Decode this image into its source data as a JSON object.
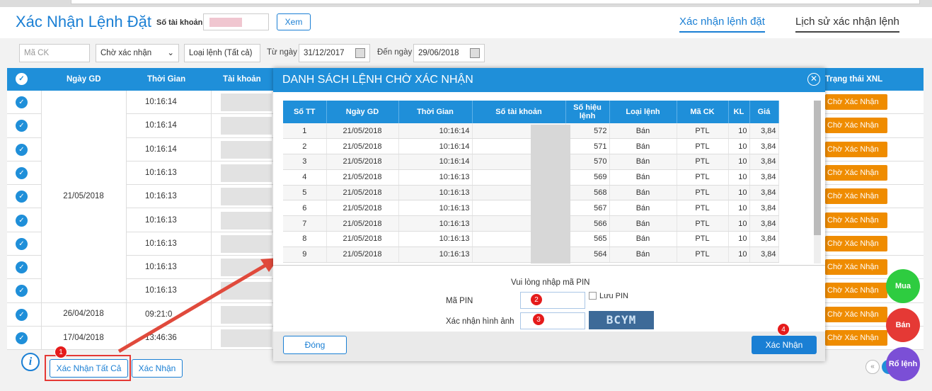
{
  "header": {
    "title": "Xác Nhận Lệnh Đặt",
    "account_label": "Số tài khoản",
    "view_button": "Xem",
    "tabs": [
      "Xác nhận lệnh đặt",
      "Lịch sử xác nhận lệnh"
    ]
  },
  "filters": {
    "stock_placeholder": "Mã CK",
    "status": "Chờ xác nhận",
    "order_type": "Loại lệnh (Tất cả)",
    "from_label": "Từ ngày",
    "from_date": "31/12/2017",
    "to_label": "Đến ngày",
    "to_date": "29/06/2018"
  },
  "grid": {
    "columns": [
      "Ngày GD",
      "Thời Gian",
      "Tài khoản",
      "Trạng thái XNL"
    ],
    "rows": [
      {
        "time": "10:16:14",
        "status": "Chờ Xác Nhận"
      },
      {
        "time": "10:16:14",
        "status": "Chờ Xác Nhận"
      },
      {
        "time": "10:16:14",
        "status": "Chờ Xác Nhận"
      },
      {
        "time": "10:16:13",
        "status": "Chờ Xác Nhận"
      },
      {
        "time": "10:16:13",
        "status": "Chờ Xác Nhận"
      },
      {
        "time": "10:16:13",
        "status": "Chờ Xác Nhận"
      },
      {
        "time": "10:16:13",
        "status": "Chờ Xác Nhận"
      },
      {
        "time": "10:16:13",
        "status": "Chờ Xác Nhận"
      },
      {
        "time": "10:16:13",
        "status": "Chờ Xác Nhận"
      },
      {
        "time": "09:21:0",
        "status": "Chờ Xác Nhận"
      },
      {
        "time": "13:46:36",
        "status": "Chờ Xác Nhận"
      }
    ],
    "date_groups": [
      "21/05/2018",
      "26/04/2018",
      "17/04/2018"
    ]
  },
  "modal": {
    "title": "DANH SÁCH LỆNH CHỜ XÁC NHẬN",
    "columns": [
      "Số TT",
      "Ngày GD",
      "Thời Gian",
      "Số tài khoản",
      "Số hiệu lệnh",
      "Loại lệnh",
      "Mã CK",
      "KL",
      "Giá"
    ],
    "rows": [
      {
        "stt": "1",
        "date": "21/05/2018",
        "time": "10:16:14",
        "id": "572",
        "type": "Bán",
        "sym": "PTL",
        "kl": "10",
        "price": "3,84"
      },
      {
        "stt": "2",
        "date": "21/05/2018",
        "time": "10:16:14",
        "id": "571",
        "type": "Bán",
        "sym": "PTL",
        "kl": "10",
        "price": "3,84"
      },
      {
        "stt": "3",
        "date": "21/05/2018",
        "time": "10:16:14",
        "id": "570",
        "type": "Bán",
        "sym": "PTL",
        "kl": "10",
        "price": "3,84"
      },
      {
        "stt": "4",
        "date": "21/05/2018",
        "time": "10:16:13",
        "id": "569",
        "type": "Bán",
        "sym": "PTL",
        "kl": "10",
        "price": "3,84"
      },
      {
        "stt": "5",
        "date": "21/05/2018",
        "time": "10:16:13",
        "id": "568",
        "type": "Bán",
        "sym": "PTL",
        "kl": "10",
        "price": "3,84"
      },
      {
        "stt": "6",
        "date": "21/05/2018",
        "time": "10:16:13",
        "id": "567",
        "type": "Bán",
        "sym": "PTL",
        "kl": "10",
        "price": "3,84"
      },
      {
        "stt": "7",
        "date": "21/05/2018",
        "time": "10:16:13",
        "id": "566",
        "type": "Bán",
        "sym": "PTL",
        "kl": "10",
        "price": "3,84"
      },
      {
        "stt": "8",
        "date": "21/05/2018",
        "time": "10:16:13",
        "id": "565",
        "type": "Bán",
        "sym": "PTL",
        "kl": "10",
        "price": "3,84"
      },
      {
        "stt": "9",
        "date": "21/05/2018",
        "time": "10:16:13",
        "id": "564",
        "type": "Bán",
        "sym": "PTL",
        "kl": "10",
        "price": "3,84"
      }
    ],
    "pin_note": "Vui lòng nhập mã PIN",
    "pin_label": "Mã PIN",
    "save_pin": "Lưu PIN",
    "captcha_label": "Xác nhận hình ảnh",
    "captcha_text": "BCYM",
    "close_button": "Đóng",
    "confirm_button": "Xác Nhận"
  },
  "footer": {
    "confirm_all": "Xác Nhận Tất Cả",
    "confirm": "Xác Nhận"
  },
  "fabs": {
    "buy": "Mua",
    "sell": "Bán",
    "basket": "Rổ lệnh"
  },
  "markers": [
    "1",
    "2",
    "3",
    "4"
  ],
  "colors": {
    "primary": "#1f8fd9",
    "status": "#ef8c00",
    "buy": "#2ecc40",
    "sell": "#e53935",
    "basket": "#7b4fd6"
  }
}
